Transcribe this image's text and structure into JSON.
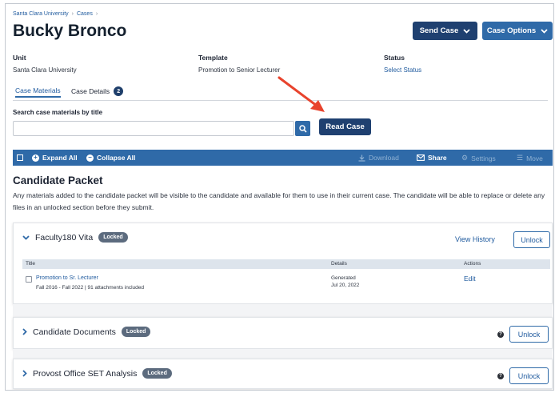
{
  "breadcrumb": {
    "items": [
      "Santa Clara University",
      "Cases"
    ]
  },
  "page_title": "Bucky Bronco",
  "header_buttons": {
    "send_case": "Send Case",
    "case_options": "Case Options"
  },
  "meta": {
    "unit_label": "Unit",
    "unit_value": "Santa Clara University",
    "template_label": "Template",
    "template_value": "Promotion to Senior Lecturer",
    "status_label": "Status",
    "status_value": "Select Status"
  },
  "tabs": [
    {
      "label": "Case Materials",
      "active": true
    },
    {
      "label": "Case Details",
      "badge": "2"
    }
  ],
  "search": {
    "label": "Search case materials by title",
    "value": "",
    "placeholder": ""
  },
  "read_case_button": "Read Case",
  "toolbar": {
    "expand_all": "Expand All",
    "collapse_all": "Collapse All",
    "download": "Download",
    "share": "Share",
    "settings": "Settings",
    "move": "Move"
  },
  "candidate_packet": {
    "title": "Candidate Packet",
    "description": "Any materials added to the candidate packet will be visible to the candidate and available for them to use in their current case. The candidate will be able to replace or delete any files in an unlocked section before they submit."
  },
  "sections": [
    {
      "title": "Faculty180 Vita",
      "badge": "Locked",
      "expanded": true,
      "view_history": "View History",
      "unlock": "Unlock",
      "table": {
        "headers": [
          "Title",
          "Details",
          "Actions"
        ],
        "rows": [
          {
            "title": "Promotion to Sr. Lecturer",
            "subtitle": "Fall 2016 - Fall 2022 | 91 attachments included",
            "details_line1": "Generated",
            "details_line2": "Jul 20, 2022",
            "action": "Edit"
          }
        ]
      }
    },
    {
      "title": "Candidate Documents",
      "badge": "Locked",
      "expanded": false,
      "unlock": "Unlock"
    },
    {
      "title": "Provost Office SET Analysis",
      "badge": "Locked",
      "expanded": false,
      "unlock": "Unlock"
    }
  ],
  "colors": {
    "annotation_arrow": "#e8432d",
    "toolbar": "#2f6aa8",
    "dark_button": "#1f4070",
    "link": "#1f5a9e"
  }
}
